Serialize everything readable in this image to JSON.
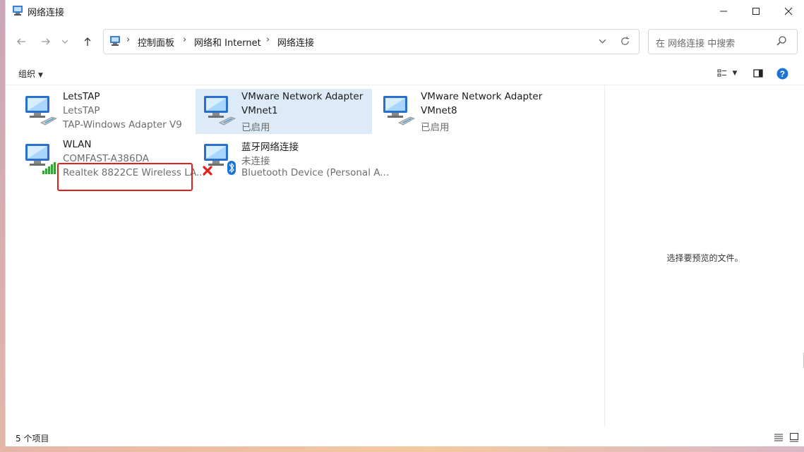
{
  "window": {
    "title": "网络连接",
    "minimize_icon": "minimize-icon",
    "maximize_icon": "maximize-icon",
    "close_icon": "close-icon"
  },
  "nav": {
    "back_icon": "arrow-left-icon",
    "forward_icon": "arrow-right-icon",
    "history_icon": "chevron-down-icon",
    "up_icon": "arrow-up-icon"
  },
  "address": {
    "crumbs": [
      "控制面板",
      "网络和 Internet",
      "网络连接"
    ],
    "separator": "›"
  },
  "search": {
    "placeholder": "在 网络连接 中搜索"
  },
  "command": {
    "organize": "组织"
  },
  "items": [
    {
      "name": "LetsTAP",
      "line2": "LetsTAP",
      "line3": "TAP-Windows Adapter V9",
      "selected": false,
      "overlay": "none"
    },
    {
      "name": "VMware Network Adapter",
      "line2": "VMnet1",
      "line3": "已启用",
      "selected": true,
      "overlay": "none"
    },
    {
      "name": "VMware Network Adapter",
      "line2": "VMnet8",
      "line3": "已启用",
      "selected": false,
      "overlay": "none"
    },
    {
      "name": "WLAN",
      "line2": "COMFAST-A386DA",
      "line3": "Realtek 8822CE Wireless LA...",
      "selected": false,
      "overlay": "signal"
    },
    {
      "name": "蓝牙网络连接",
      "line2": "未连接",
      "line3": "Bluetooth Device (Personal A...",
      "selected": false,
      "overlay": "bluetooth-disconnected"
    }
  ],
  "preview": {
    "text": "选择要预览的文件。"
  },
  "status": {
    "count": "5 个项目"
  },
  "colors": {
    "selected": "#dcebf7",
    "highlight": "#e0201b",
    "help": "#1a73d6"
  }
}
